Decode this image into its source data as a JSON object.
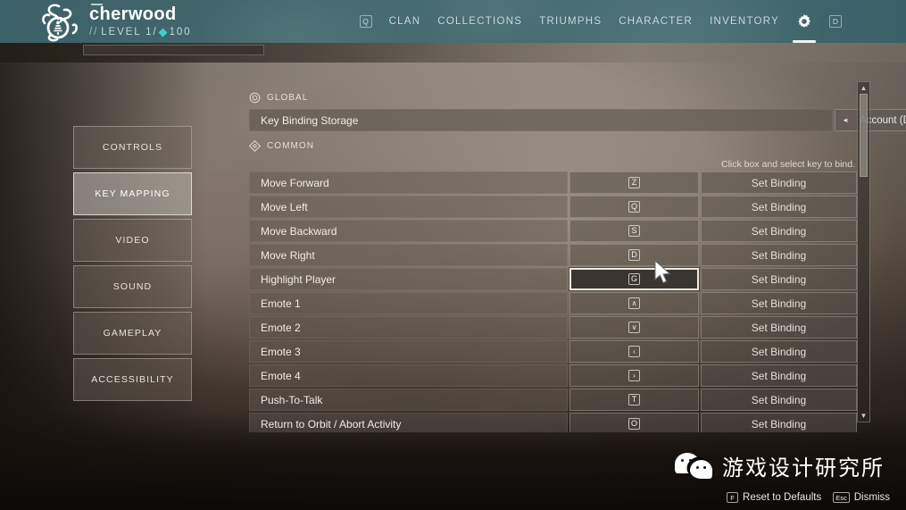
{
  "header": {
    "player_name": "cherwood",
    "level_prefix": "//",
    "level_text": "LEVEL 1/",
    "power_value": "100",
    "nav_key_left": "Q",
    "nav_key_right": "D",
    "nav_items": [
      {
        "label": "CLAN"
      },
      {
        "label": "COLLECTIONS"
      },
      {
        "label": "TRIUMPHS"
      },
      {
        "label": "CHARACTER"
      },
      {
        "label": "INVENTORY"
      }
    ],
    "settings_icon": "gear-icon"
  },
  "sidebar": {
    "items": [
      {
        "label": "CONTROLS",
        "active": false
      },
      {
        "label": "KEY MAPPING",
        "active": true
      },
      {
        "label": "VIDEO",
        "active": false
      },
      {
        "label": "SOUND",
        "active": false
      },
      {
        "label": "GAMEPLAY",
        "active": false
      },
      {
        "label": "ACCESSIBILITY",
        "active": false
      }
    ]
  },
  "panel": {
    "global_section": {
      "icon": "circle-icon",
      "label": "GLOBAL",
      "storage_row_label": "Key Binding Storage",
      "account_value": "Account (Default)",
      "arrow_left": "◄",
      "arrow_right": "►"
    },
    "common_section": {
      "icon": "diamond-icon",
      "label": "COMMON",
      "hint": "Click box and select key to bind.",
      "set_binding_label": "Set Binding",
      "rows": [
        {
          "action": "Move Forward",
          "key": "Z",
          "key_type": "letter",
          "focused": false
        },
        {
          "action": "Move Left",
          "key": "Q",
          "key_type": "letter",
          "focused": false
        },
        {
          "action": "Move Backward",
          "key": "S",
          "key_type": "letter",
          "focused": false
        },
        {
          "action": "Move Right",
          "key": "D",
          "key_type": "letter",
          "focused": false
        },
        {
          "action": "Highlight Player",
          "key": "G",
          "key_type": "letter",
          "focused": true
        },
        {
          "action": "Emote 1",
          "key": "∧",
          "key_type": "arrow",
          "focused": false
        },
        {
          "action": "Emote 2",
          "key": "∨",
          "key_type": "arrow",
          "focused": false
        },
        {
          "action": "Emote 3",
          "key": "‹",
          "key_type": "arrow",
          "focused": false
        },
        {
          "action": "Emote 4",
          "key": "›",
          "key_type": "arrow",
          "focused": false
        },
        {
          "action": "Push-To-Talk",
          "key": "T",
          "key_type": "letter",
          "focused": false
        },
        {
          "action": "Return to Orbit / Abort Activity",
          "key": "O",
          "key_type": "letter",
          "focused": false
        },
        {
          "action": "",
          "key": "",
          "key_type": "letter",
          "focused": false
        }
      ]
    },
    "scrollbar": {
      "up": "▲",
      "down": "▼"
    }
  },
  "footer": {
    "reset_key": "F",
    "reset_label": "Reset to Defaults",
    "dismiss_key": "Esc",
    "dismiss_label": "Dismiss"
  },
  "watermark": {
    "text": "游戏设计研究所",
    "logo": "wechat-logo"
  },
  "colors": {
    "header_teal": "#436a70",
    "accent_cyan": "#37d2cd",
    "panel_row": "#60584f",
    "focus_white": "#eceae5"
  }
}
